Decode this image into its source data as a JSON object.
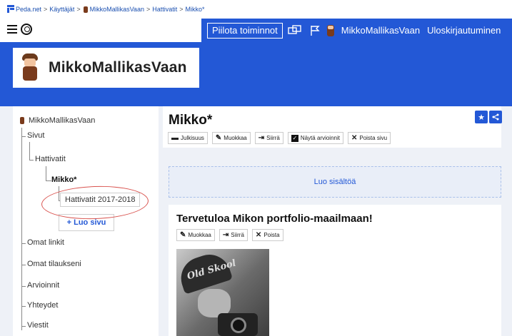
{
  "breadcrumb": {
    "items": [
      "Peda.net",
      "Käyttäjät",
      "MikkoMallikasVaan",
      "Hattivatit",
      "Mikko*"
    ],
    "separator": ">"
  },
  "toolbar": {
    "hide_label": "Piilota toiminnot",
    "username": "MikkoMallikasVaan",
    "logout_label": "Uloskirjautuminen"
  },
  "site": {
    "title": "MikkoMallikasVaan"
  },
  "sidebar": {
    "root": "MikkoMallikasVaan",
    "sivut": "Sivut",
    "hattivatit": "Hattivatit",
    "mikko": "Mikko*",
    "hattivatit_year": "Hattivatit 2017-2018",
    "add_page": "+ Luo sivu",
    "items": [
      "Omat linkit",
      "Omat tilaukseni",
      "Arvioinnit",
      "Yhteydet",
      "Viestit"
    ]
  },
  "page": {
    "title": "Mikko*",
    "actions": [
      "Julkisuus",
      "Muokkaa",
      "Siirrä",
      "Näytä arvioinnit",
      "Poista sivu"
    ]
  },
  "create": {
    "label": "Luo sisältöä"
  },
  "welcome": {
    "title": "Tervetuloa Mikon portfolio-maailmaan!",
    "actions": [
      "Muokkaa",
      "Siirrä",
      "Poista"
    ],
    "cap_text": "Old Skool"
  },
  "colors": {
    "brand_blue": "#2358d6",
    "background": "#eef1f7",
    "annotation_red": "#d9534f"
  }
}
